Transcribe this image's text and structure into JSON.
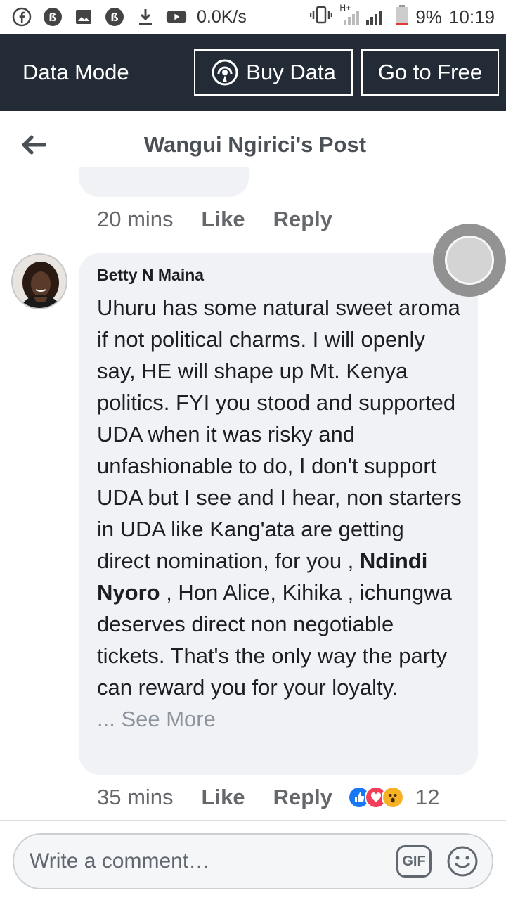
{
  "statusbar": {
    "net_speed": "0.0K/s",
    "network_type": "H+",
    "battery": "9%",
    "time": "10:19"
  },
  "databar": {
    "mode_label": "Data Mode",
    "buy_label": "Buy Data",
    "free_label": "Go to Free"
  },
  "header": {
    "title": "Wangui Ngirici's Post"
  },
  "prev_comment": {
    "time": "20 mins",
    "like": "Like",
    "reply": "Reply"
  },
  "comment": {
    "author": "Betty N Maina",
    "text_before": "Uhuru has some natural sweet aroma if not political charms. I will openly say, HE will shape up Mt. Kenya politics.  FYI you stood and supported UDA when it was risky and unfashionable to do,  I don't support UDA but I see and I hear, non starters in UDA like Kang'ata are getting direct nomination,  for you ,",
    "mention": "Ndindi Nyoro",
    "text_after": ", Hon Alice, Kihika , ichungwa deserves direct non negotiable tickets.  That's the only way the party can reward you for your loyalty.",
    "see_more": "... See More",
    "time": "35 mins",
    "like": "Like",
    "reply": "Reply",
    "reaction_count": "12",
    "reactions": [
      "like-reaction-icon",
      "love-reaction-icon",
      "wow-reaction-icon"
    ]
  },
  "composer": {
    "placeholder": "Write a comment…",
    "gif_label": "GIF"
  },
  "colors": {
    "databar_bg": "#222b36",
    "bubble_bg": "#f0f2f5",
    "like_blue": "#1877f2",
    "love_red": "#f33e58",
    "wow_yellow": "#f7b125"
  }
}
